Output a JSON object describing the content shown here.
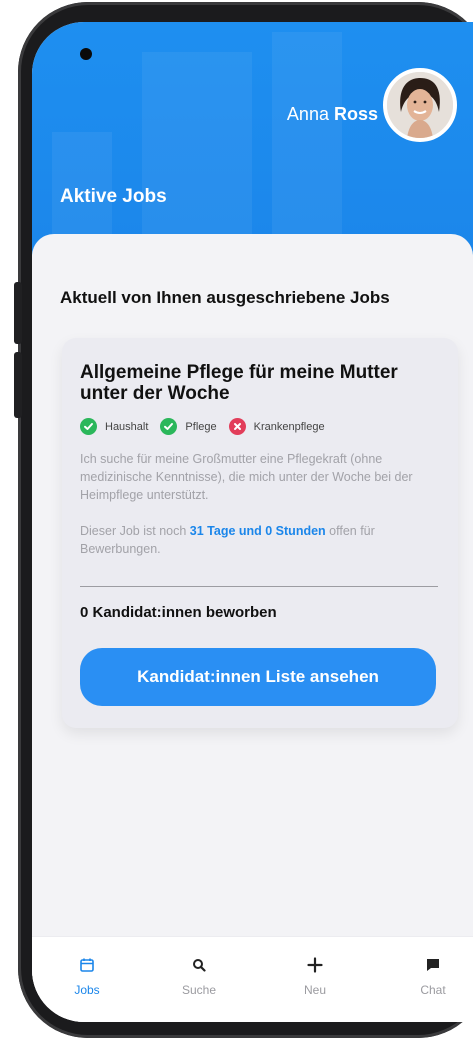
{
  "header": {
    "user_first_name": "Anna",
    "user_last_name": "Ross",
    "title": "Aktive Jobs"
  },
  "main": {
    "section_title": "Aktuell von Ihnen ausgeschriebene Jobs",
    "job": {
      "title": "Allgemeine Pflege für meine Mutter unter der Woche",
      "tags": [
        {
          "label": "Haushalt",
          "status": "included",
          "color": "#2bb75b"
        },
        {
          "label": "Pflege",
          "status": "included",
          "color": "#2bb75b"
        },
        {
          "label": "Krankenpflege",
          "status": "excluded",
          "color": "#e23d5a"
        }
      ],
      "description": "Ich suche für meine Großmutter eine Pflegekraft (ohne medizinische Kenntnisse), die mich unter der Woche bei der Heimpflege unterstützt.",
      "remaining_prefix": "Dieser Job ist noch ",
      "remaining_value": "31 Tage und 0 Stunden",
      "remaining_suffix": " offen für Bewerbungen.",
      "applicants": "0 Kandidat:innen beworben",
      "cta_label": "Kandidat:innen Liste ansehen"
    }
  },
  "bottom_nav": {
    "items": [
      {
        "label": "Jobs",
        "icon": "calendar-icon",
        "active": true
      },
      {
        "label": "Suche",
        "icon": "search-icon",
        "active": false
      },
      {
        "label": "Neu",
        "icon": "plus-icon",
        "active": false
      },
      {
        "label": "Chat",
        "icon": "chat-icon",
        "active": false
      }
    ]
  },
  "colors": {
    "accent": "#1b86ea",
    "check": "#2bb75b",
    "cross": "#e23d5a"
  }
}
